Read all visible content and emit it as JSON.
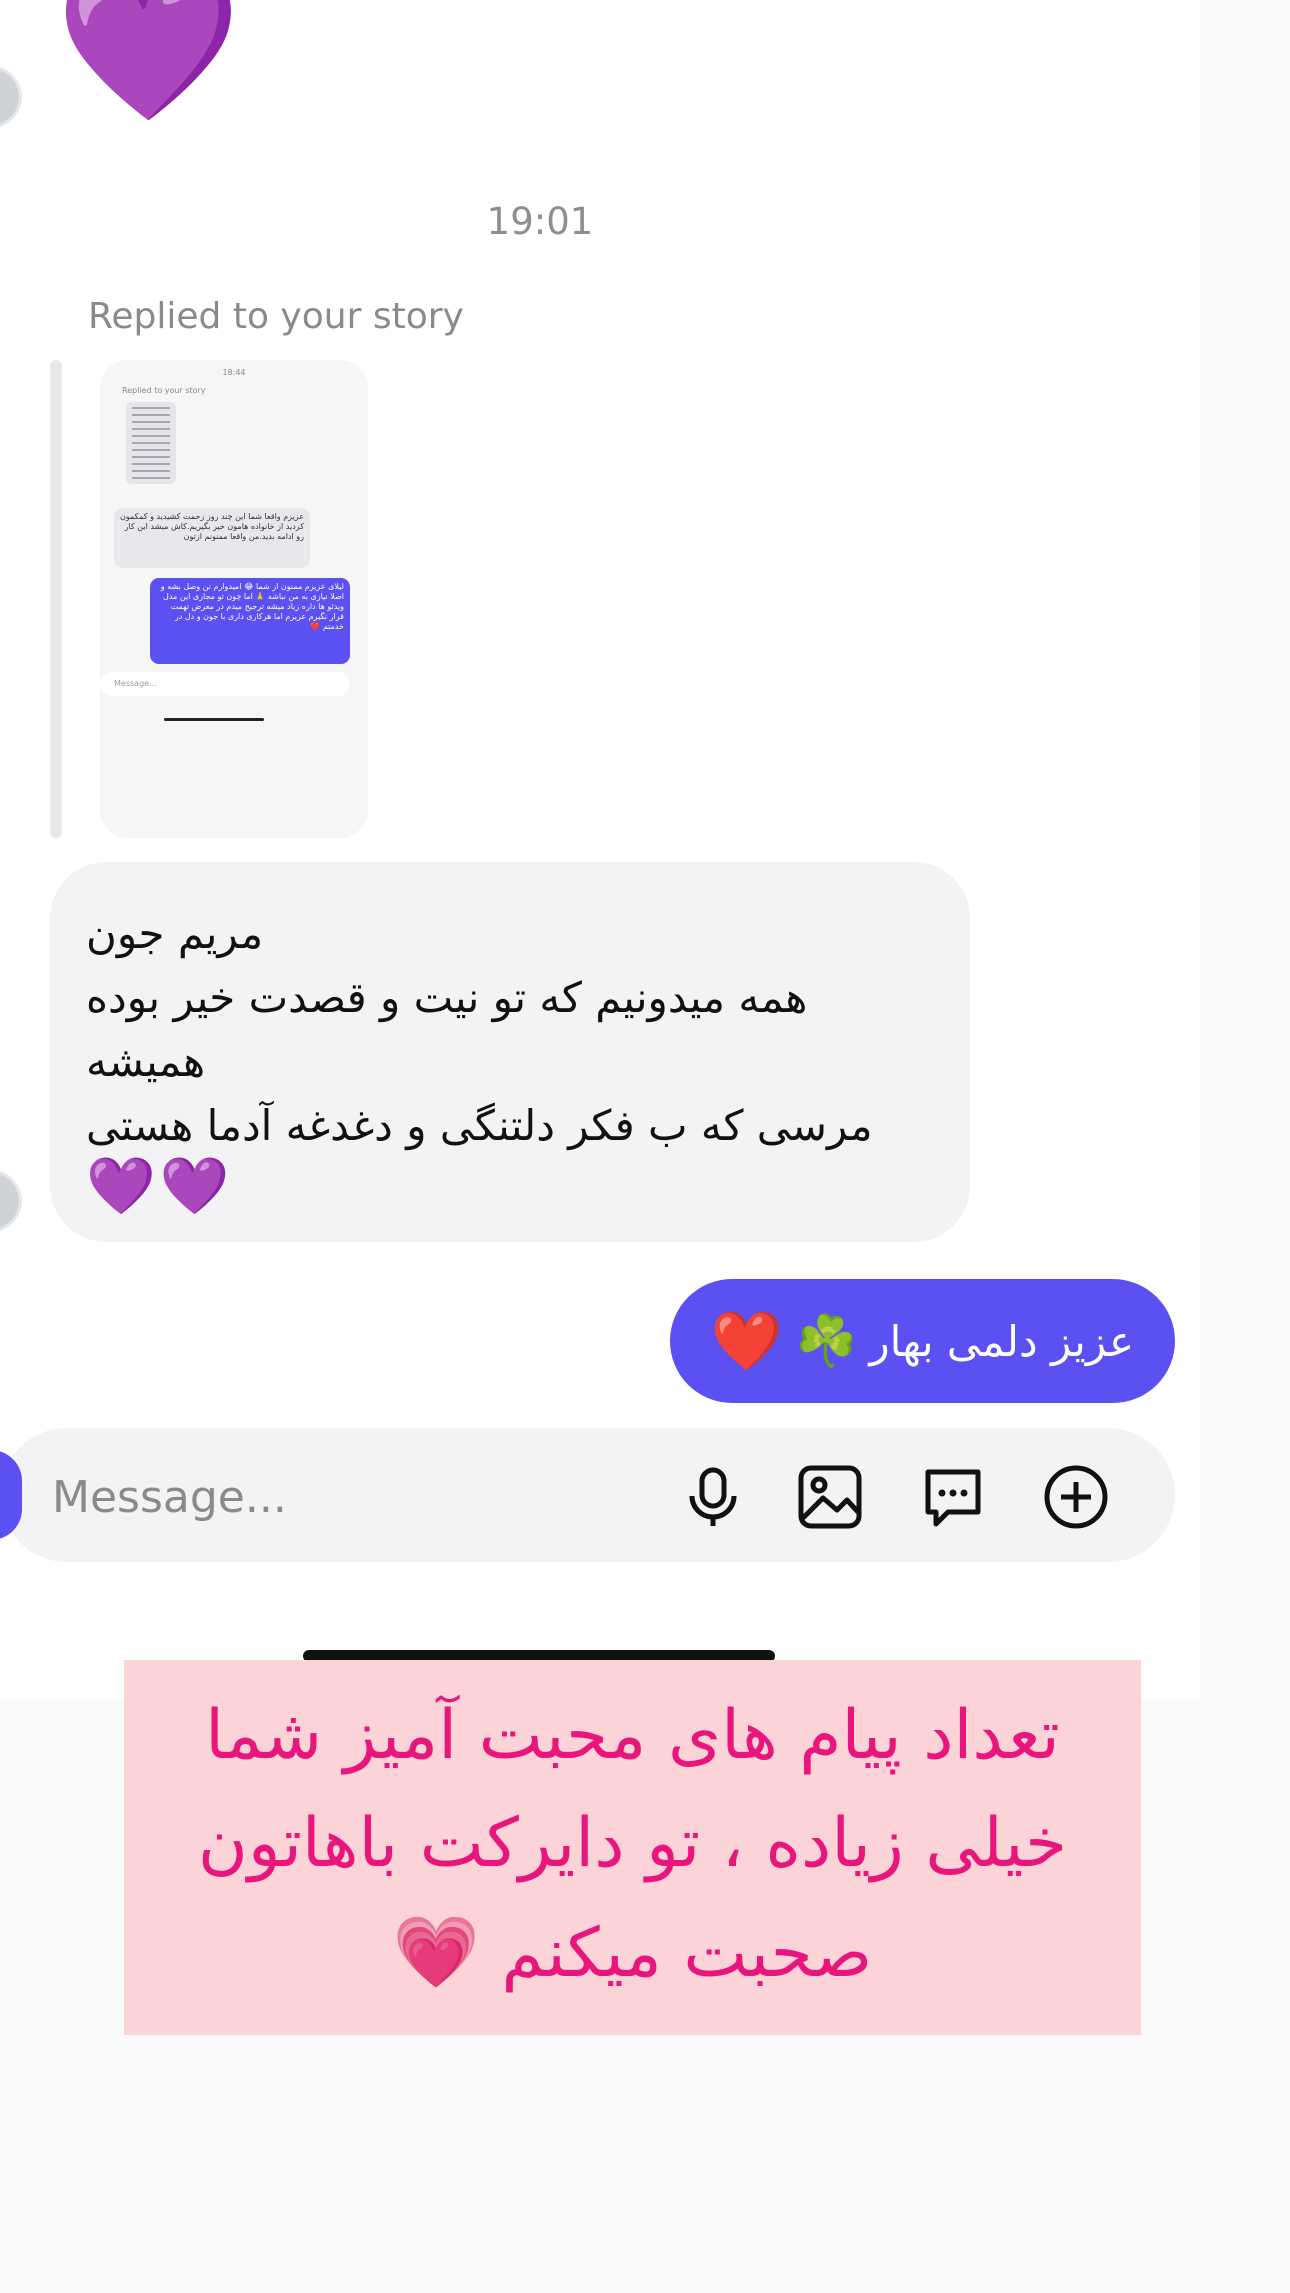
{
  "thread": {
    "big_heart": "💜",
    "timestamp": "19:01",
    "replied_label": "Replied to your story"
  },
  "story_preview": {
    "time": "18:44",
    "replied_label": "Replied to your story",
    "incoming_text": "عزیزم واقعا شما این چند روز زحمت کشیدید و کمکمون کردید از خانواده هامون خیر بگیریم.کاش میشد این کار رو ادامه بدید.من واقعا ممنونم ازتون",
    "outgoing_text": "لیلای عزیزم ممنون از شما 😂 امیدوارم تن وصل بشه و اصلا نیازی به من نباشه 🙏 اما چون تو مجازی این مدل ویدئو ها داره زیاد میشه ترجیح میدم در معرض تهمت قرار نگیرم عزیزم اما هرکاری داری با جون و دل در خدمتم ❤️",
    "input_placeholder": "Message..."
  },
  "incoming_message": {
    "lines": [
      "مریم جون",
      "همه میدونیم که تو نیت و قصدت خیر بوده",
      "همیشه",
      "مرسی که ب فکر دلتنگی و دغدغه آدما هستی"
    ],
    "hearts": "💜💜"
  },
  "outgoing_message": {
    "text": "عزیز دلمی بهار",
    "clover": "☘️",
    "heart": "❤️"
  },
  "composer": {
    "placeholder": "Message..."
  },
  "banner": {
    "line1": "تعداد پیام های محبت آمیز شما",
    "line2": "خیلی زیاده ، تو دایرکت باهاتون",
    "line3": "صحبت میکنم",
    "heart": "💗"
  }
}
